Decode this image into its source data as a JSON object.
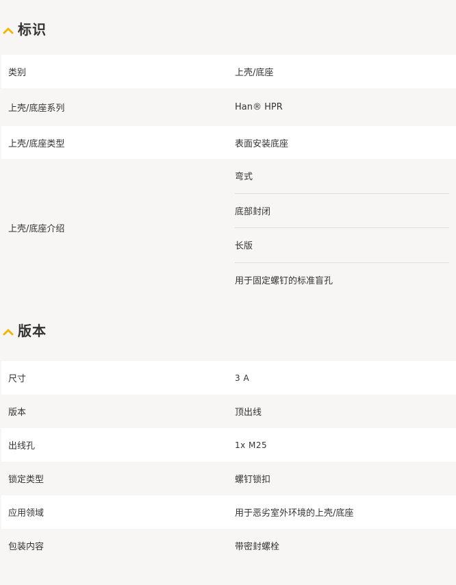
{
  "sections": [
    {
      "title": "标识",
      "rows": [
        {
          "label": "类别",
          "value": "上壳/底座"
        },
        {
          "label": "上壳/底座系列",
          "value": "Han® HPR"
        },
        {
          "label": "上壳/底座类型",
          "value": "表面安装底座"
        },
        {
          "label": "上壳/底座介绍",
          "values": [
            "弯式",
            "底部封闭",
            "长版",
            "用于固定螺钉的标准盲孔"
          ]
        }
      ]
    },
    {
      "title": "版本",
      "rows": [
        {
          "label": "尺寸",
          "value": "3 A"
        },
        {
          "label": "版本",
          "value": "顶出线"
        },
        {
          "label": "出线孔",
          "value": "1x M25"
        },
        {
          "label": "锁定类型",
          "value": "螺钉锁扣"
        },
        {
          "label": "应用领域",
          "value": "用于恶劣室外环境的上壳/底座"
        },
        {
          "label": "包装内容",
          "value": "带密封螺栓"
        }
      ]
    }
  ],
  "colors": {
    "accent": "#f2b705",
    "row_white": "#ffffff",
    "row_grey": "#f7f6f4"
  },
  "icons": {
    "section_toggle": "chevron-up-icon"
  }
}
